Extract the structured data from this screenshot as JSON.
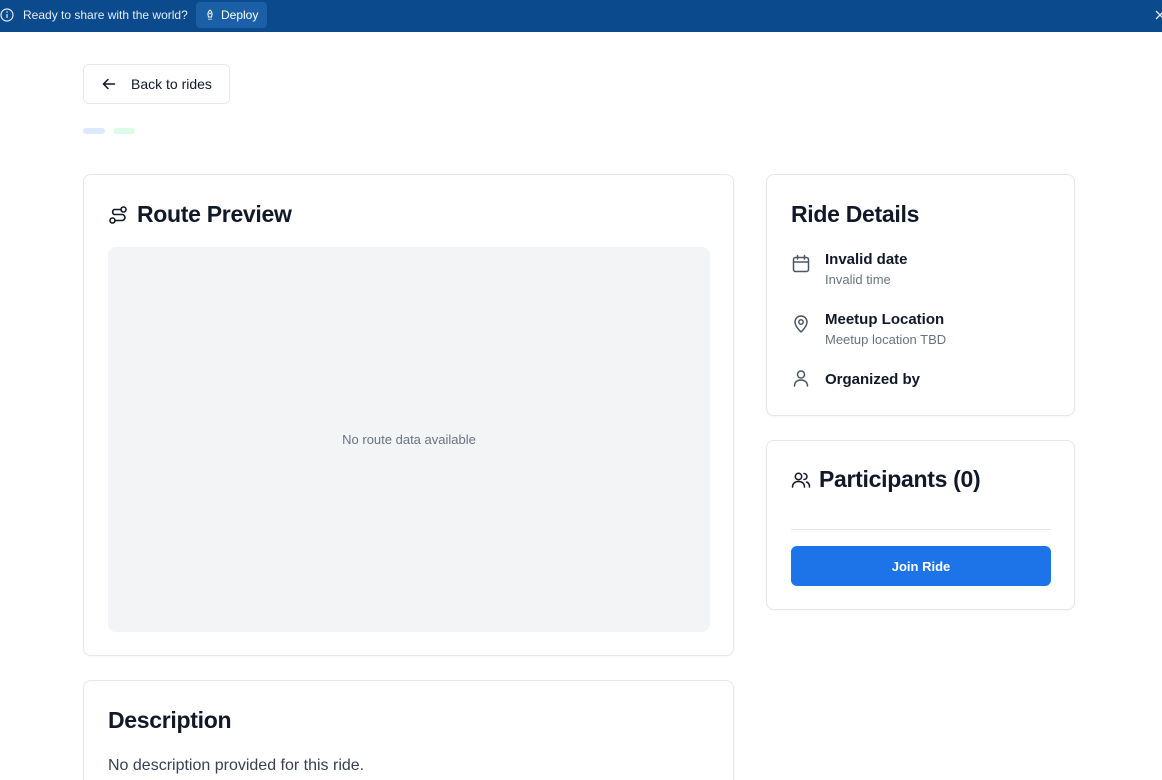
{
  "banner": {
    "message": "Ready to share with the world?",
    "deploy_label": "Deploy",
    "color": "#0b4a8c"
  },
  "back_label": "Back to rides",
  "route": {
    "title": "Route Preview",
    "empty_text": "No route data available"
  },
  "description": {
    "title": "Description",
    "text": "No description provided for this ride."
  },
  "details": {
    "title": "Ride Details",
    "date": "Invalid date",
    "time": "Invalid time",
    "location_label": "Meetup Location",
    "location_value": "Meetup location TBD",
    "organizer_label": "Organized by"
  },
  "participants": {
    "title": "Participants (0)",
    "join_label": "Join Ride",
    "accent": "#1d74e8"
  },
  "icons": [
    "info-icon",
    "rocket-icon",
    "close-icon",
    "arrow-left-icon",
    "route-icon",
    "calendar-icon",
    "map-pin-icon",
    "user-icon",
    "users-icon"
  ]
}
